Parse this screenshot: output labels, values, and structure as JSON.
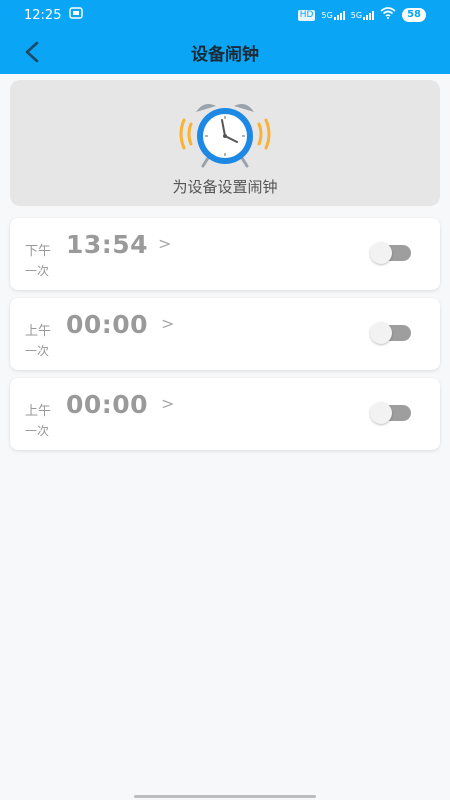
{
  "status_bar": {
    "time": "12:25",
    "hd": "HD",
    "net1": "5G",
    "net2": "5G",
    "battery": "58"
  },
  "nav": {
    "title": "设备闹钟"
  },
  "hero": {
    "caption": "为设备设置闹钟"
  },
  "alarms": [
    {
      "ampm": "下午",
      "time": "13:54",
      "repeat": "一次",
      "enabled": false
    },
    {
      "ampm": "上午",
      "time": "00:00",
      "repeat": "一次",
      "enabled": false
    },
    {
      "ampm": "上午",
      "time": "00:00",
      "repeat": "一次",
      "enabled": false
    }
  ],
  "colors": {
    "accent": "#0aa6f5",
    "clock_blue": "#1e88e5",
    "ring_yellow": "#f9b233"
  },
  "icons": {
    "back": "chevron-left-icon",
    "hero": "alarm-clock-icon",
    "row_arrow": "chevron-right-icon"
  }
}
